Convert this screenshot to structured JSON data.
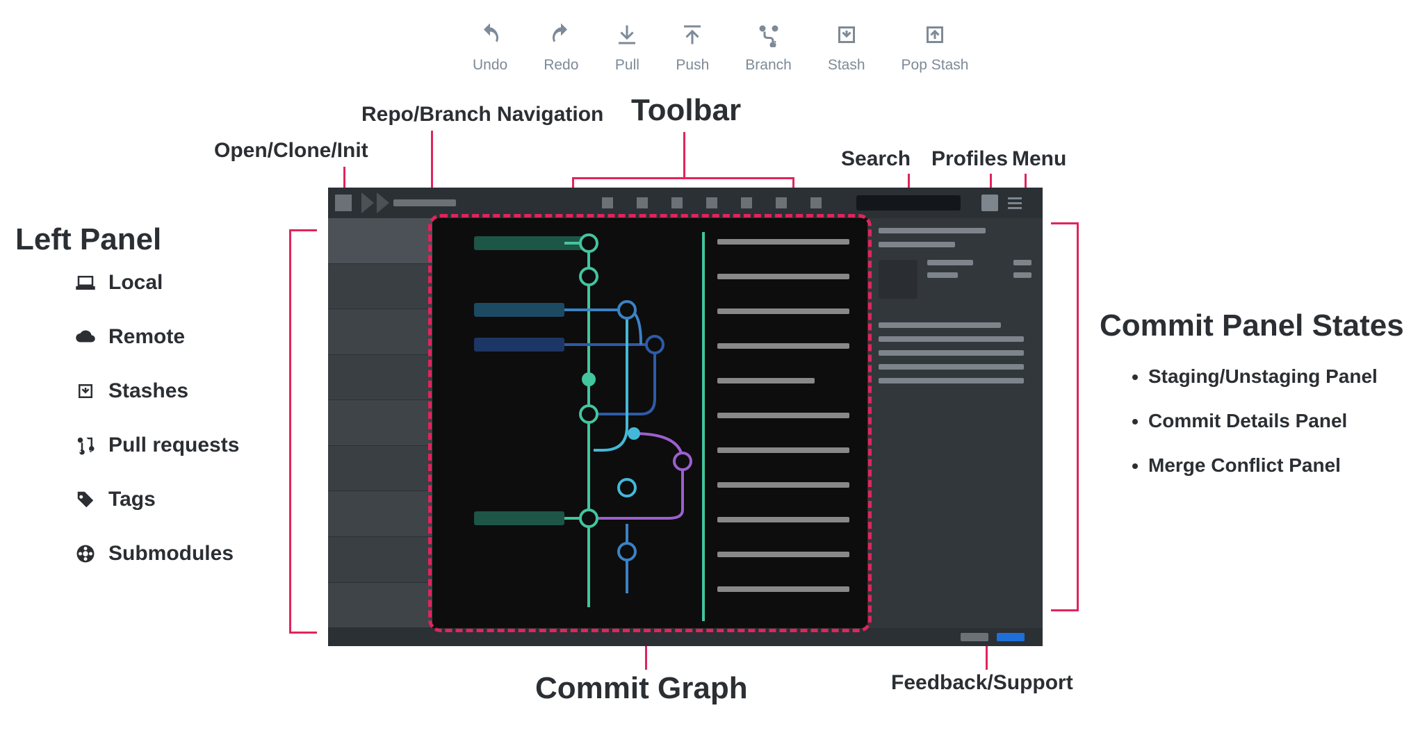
{
  "toolbar": {
    "items": [
      {
        "label": "Undo",
        "icon": "undo-icon"
      },
      {
        "label": "Redo",
        "icon": "redo-icon"
      },
      {
        "label": "Pull",
        "icon": "pull-icon"
      },
      {
        "label": "Push",
        "icon": "push-icon"
      },
      {
        "label": "Branch",
        "icon": "branch-icon"
      },
      {
        "label": "Stash",
        "icon": "stash-icon"
      },
      {
        "label": "Pop Stash",
        "icon": "popstash-icon"
      }
    ]
  },
  "annotations": {
    "toolbar": "Toolbar",
    "repo_nav": "Repo/Branch Navigation",
    "open_clone": "Open/Clone/Init",
    "search": "Search",
    "profiles": "Profiles",
    "menu": "Menu",
    "left_panel": "Left Panel",
    "commit_graph": "Commit Graph",
    "commit_states": "Commit Panel States",
    "feedback": "Feedback/Support"
  },
  "left_panel_legend": [
    {
      "label": "Local",
      "icon": "laptop-icon"
    },
    {
      "label": "Remote",
      "icon": "cloud-icon"
    },
    {
      "label": "Stashes",
      "icon": "stash-box-icon"
    },
    {
      "label": "Pull requests",
      "icon": "pr-icon"
    },
    {
      "label": "Tags",
      "icon": "tag-icon"
    },
    {
      "label": "Submodules",
      "icon": "submodule-icon"
    }
  ],
  "commit_panel_bullets": [
    "Staging/Unstaging Panel",
    "Commit Details Panel",
    "Merge Conflict Panel"
  ],
  "colors": {
    "pink": "#e0245c",
    "green": "#43c59e",
    "blue": "#3b82c4",
    "cyan": "#44b8d8",
    "purple": "#9d5fd0",
    "navy": "#2e5aa8",
    "gray": "#7d868f"
  }
}
